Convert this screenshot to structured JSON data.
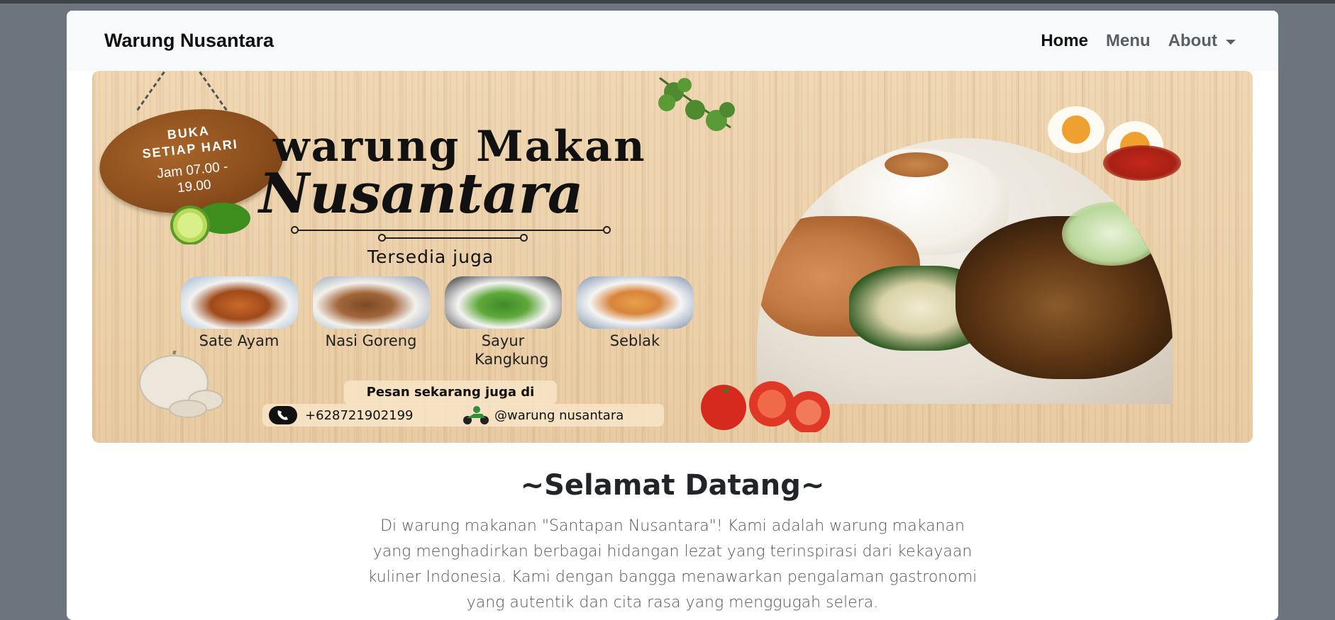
{
  "navbar": {
    "brand": "Warung Nusantara",
    "links": [
      {
        "label": "Home",
        "active": true
      },
      {
        "label": "Menu",
        "active": false
      },
      {
        "label": "About",
        "active": false,
        "dropdown": true
      }
    ]
  },
  "banner": {
    "sign": {
      "line1": "BUKA",
      "line2": "SETIAP HARI",
      "line3": "Jam 07.00 -",
      "line4": "19.00"
    },
    "title_line1": "warung Makan",
    "title_line2": "Nusantara",
    "subtitle": "Tersedia juga",
    "dishes": [
      {
        "name": "Sate Ayam"
      },
      {
        "name": "Nasi Goreng"
      },
      {
        "name": "Sayur Kangkung"
      },
      {
        "name": "Seblak"
      }
    ],
    "order_text": "Pesan sekarang juga di",
    "phone": "+628721902199",
    "social": "@warung nusantara"
  },
  "welcome": {
    "heading": "~Selamat Datang~",
    "text": "Di warung makanan \"Santapan Nusantara\"! Kami adalah warung makanan yang menghadirkan berbagai hidangan lezat yang terinspirasi dari kekayaan kuliner Indonesia. Kami dengan bangga menawarkan pengalaman gastronomi yang autentik dan cita rasa yang menggugah selera."
  },
  "colors": {
    "page_bg": "#6c757d",
    "navbar_bg": "#f8f9fa",
    "sign_wood": "#8a4d1c"
  }
}
